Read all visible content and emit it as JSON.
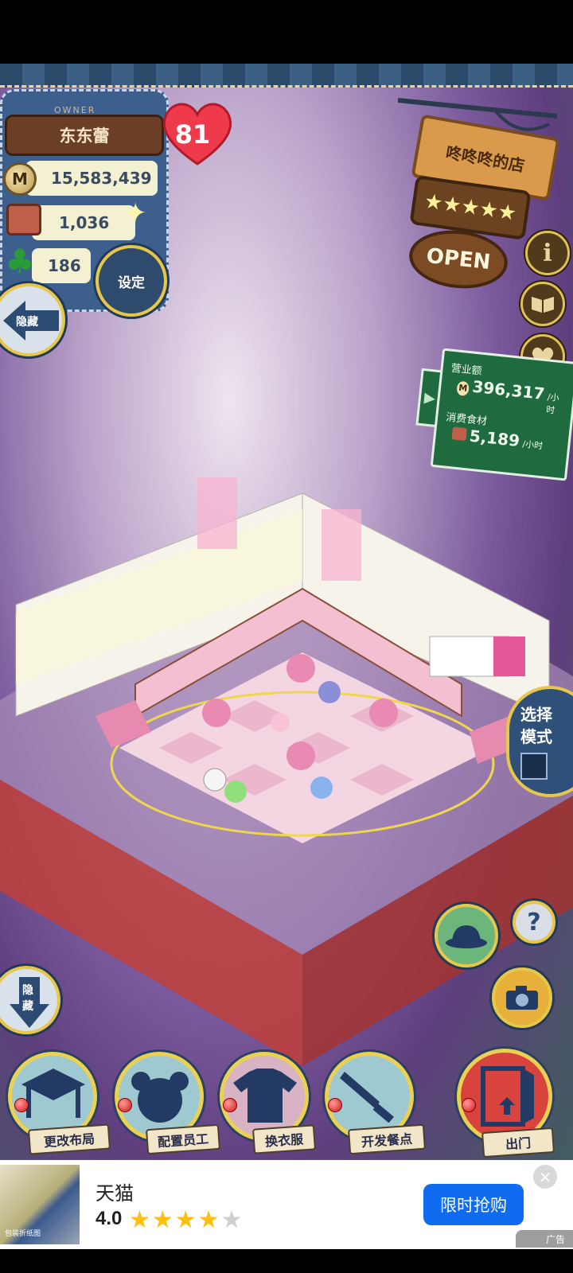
{
  "player": {
    "owner_tag": "OWNER",
    "name": "东东蕾",
    "level": "81",
    "coins": "15,583,439",
    "coin_symbol": "M",
    "ingredients": "1,036",
    "clovers": "186"
  },
  "buttons": {
    "settings": "设定",
    "hide_top": "隐藏",
    "hide_bottom_1": "隐",
    "hide_bottom_2": "藏",
    "select_mode_1": "选择",
    "select_mode_2": "模式"
  },
  "shop": {
    "name": "咚咚咚的店",
    "stars": "★★★★★",
    "open": "OPEN"
  },
  "revenue": {
    "sales_label": "营业额",
    "sales_value": "396,317",
    "sales_unit": "/小时",
    "consume_label": "消费食材",
    "consume_value": "5,189",
    "consume_unit": "/小时"
  },
  "toolbar": [
    {
      "label": "更改布局"
    },
    {
      "label": "配置员工"
    },
    {
      "label": "换衣服"
    },
    {
      "label": "开发餐点"
    },
    {
      "label": "出门"
    }
  ],
  "ad": {
    "title": "天猫",
    "rating": "4.0",
    "stars_filled": "★★★★",
    "stars_empty": "★",
    "cta": "限时抢购",
    "close": "×",
    "tag": "广告",
    "thumb_text": "包装折纸图"
  },
  "colors": {
    "accent_gold": "#e7c64c",
    "panel_blue": "#3c5f8e",
    "ad_blue": "#0f6cf0",
    "revenue_green": "#1f6b3f"
  }
}
